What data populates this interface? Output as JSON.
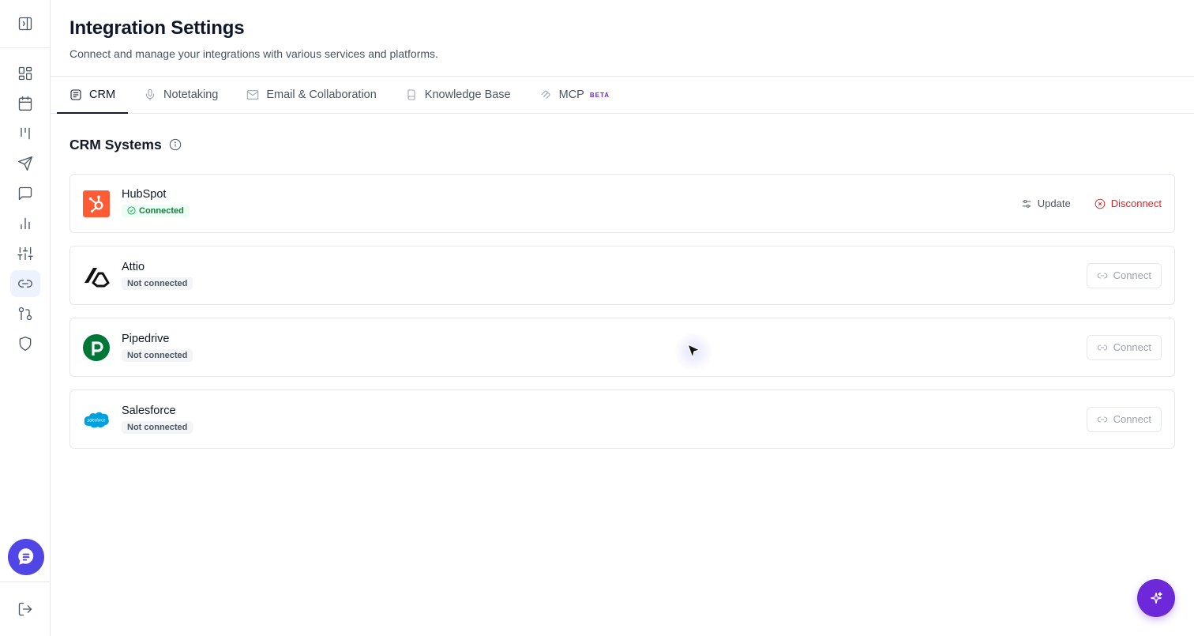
{
  "page": {
    "title": "Integration Settings",
    "subtitle": "Connect and manage your integrations with various services and platforms."
  },
  "tabs": [
    {
      "label": "CRM",
      "icon": "crm-icon",
      "active": true
    },
    {
      "label": "Notetaking",
      "icon": "microphone-icon",
      "active": false
    },
    {
      "label": "Email & Collaboration",
      "icon": "mail-icon",
      "active": false
    },
    {
      "label": "Knowledge Base",
      "icon": "book-icon",
      "active": false
    },
    {
      "label": "MCP",
      "icon": "mcp-icon",
      "active": false,
      "badge": "BETA"
    }
  ],
  "section": {
    "title": "CRM Systems"
  },
  "integrations": [
    {
      "name": "HubSpot",
      "status": "Connected",
      "actions": {
        "update": "Update",
        "disconnect": "Disconnect"
      }
    },
    {
      "name": "Attio",
      "status": "Not connected",
      "actions": {
        "connect": "Connect"
      }
    },
    {
      "name": "Pipedrive",
      "status": "Not connected",
      "actions": {
        "connect": "Connect"
      }
    },
    {
      "name": "Salesforce",
      "status": "Not connected",
      "actions": {
        "connect": "Connect"
      },
      "logo_text": "salesforce"
    }
  ],
  "sidebar": {
    "items": [
      "dashboard-icon",
      "calendar-icon",
      "pipeline-icon",
      "send-icon",
      "chat-icon",
      "chart-icon",
      "sliders-icon",
      "link-icon",
      "git-icon",
      "shield-icon"
    ],
    "active": "link-icon"
  },
  "colors": {
    "accent": "#6d28d9",
    "hubspot": "#ff5c35",
    "pipedrive": "#017737",
    "salesforce": "#00a1e0",
    "connected": "#15803d",
    "danger": "#dc2626"
  }
}
